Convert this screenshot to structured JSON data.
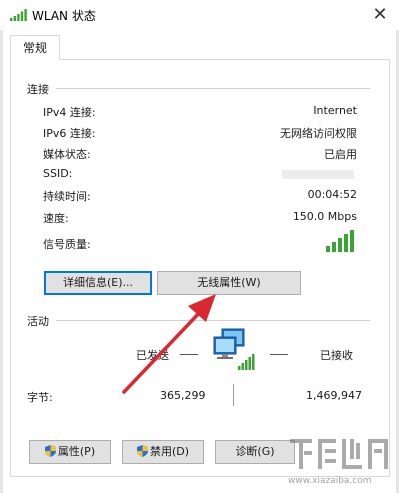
{
  "window": {
    "title": "WLAN 状态",
    "close_glyph": "✕"
  },
  "tab": {
    "label": "常规"
  },
  "connection": {
    "section_label": "连接",
    "rows": [
      {
        "label": "IPv4 连接:",
        "value": "Internet"
      },
      {
        "label": "IPv6 连接:",
        "value": "无网络访问权限"
      },
      {
        "label": "媒体状态:",
        "value": "已启用"
      },
      {
        "label": "SSID:",
        "value": ""
      },
      {
        "label": "持续时间:",
        "value": "00:04:52"
      },
      {
        "label": "速度:",
        "value": "150.0 Mbps"
      }
    ],
    "signal_label": "信号质量:",
    "signal_bars": 5,
    "details_button": "详细信息(E)...",
    "wireless_props_button": "无线属性(W)"
  },
  "activity": {
    "section_label": "活动",
    "sent_label": "已发送",
    "received_label": "已接收",
    "bytes_label": "字节:",
    "bytes_sent": "365,299",
    "bytes_received": "1,469,947"
  },
  "buttons": {
    "properties": "属性(P)",
    "disable": "禁用(D)",
    "diagnose": "诊断(G)"
  },
  "watermark": {
    "url": "www.xiazaiba.com"
  },
  "colors": {
    "signal_green": "#3aa535",
    "arrow_red": "#d9282f",
    "focus_blue": "#0078d7"
  }
}
